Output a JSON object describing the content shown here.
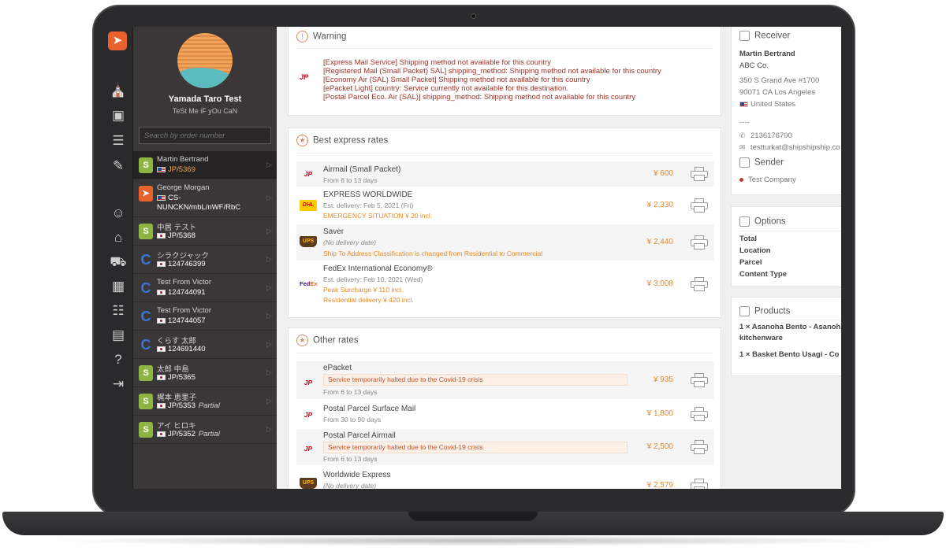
{
  "user": {
    "name": "Yamada Taro Test",
    "tagline": "TeSt Me iF yOu CaN"
  },
  "search": {
    "placeholder": "Search by order number"
  },
  "orders": [
    {
      "name": "Martin Bertrand",
      "ref": "JP/5369",
      "flag": "us",
      "store": "shopify",
      "partial": ""
    },
    {
      "name": "George Morgan",
      "ref": "CS-",
      "ref2": "NUNCKN/mbL/nWF/RbC",
      "flag": "us",
      "store": "rocket",
      "partial": ""
    },
    {
      "name": "中居 テスト",
      "ref": "JP/5368",
      "flag": "jp",
      "store": "shopify",
      "partial": ""
    },
    {
      "name": "シラクジャック",
      "ref": "124746399",
      "flag": "jp",
      "store": "cube",
      "partial": ""
    },
    {
      "name": "Test From Victor",
      "ref": "124744091",
      "flag": "jp",
      "store": "cube",
      "partial": ""
    },
    {
      "name": "Test From Victor",
      "ref": "124744057",
      "flag": "jp",
      "store": "cube",
      "partial": ""
    },
    {
      "name": "くらす 太郎",
      "ref": "124691440",
      "flag": "jp",
      "store": "cube",
      "partial": ""
    },
    {
      "name": "太郎 中島",
      "ref": "JP/5365",
      "flag": "jp",
      "store": "shopify",
      "partial": ""
    },
    {
      "name": "梶本 恵里子",
      "ref": "JP/5353",
      "flag": "jp",
      "store": "shopify",
      "partial": "Partial"
    },
    {
      "name": "アイ ヒロキ",
      "ref": "JP/5352",
      "flag": "jp",
      "store": "shopify",
      "partial": "Partial"
    }
  ],
  "warning": {
    "title": "Warning",
    "lines": [
      "[Express Mail Service] Shipping method not available for this country",
      "[Registered Mail (Small Packet) SAL] shipping_method: Shipping method not available for this country",
      "[Economy Air (SAL) Small Packet] Shipping method not available for this country",
      "[ePacket Light] country: Service currently not available for this destination.",
      "[Postal Parcel Eco. Air (SAL)] shipping_method: Shipping method not available for this country"
    ]
  },
  "best_rates": {
    "title": "Best express rates",
    "rates": [
      {
        "carrier": "JP",
        "name": "Airmail (Small Packet)",
        "sub": "From 6 to 13 days",
        "price": "¥ 600",
        "notes": []
      },
      {
        "carrier": "DHL",
        "name": "EXPRESS WORLDWIDE",
        "sub": "Est. delivery: Feb 5, 2021 (Fri)",
        "price": "¥ 2,330",
        "notes": [
          "EMERGENCY SITUATION ¥ 20 incl."
        ]
      },
      {
        "carrier": "UPS",
        "name": "Saver",
        "sub": "(No delivery date)",
        "price": "¥ 2,440",
        "notes": [
          "Ship To Address Classification is changed from Residential to Commercial"
        ]
      },
      {
        "carrier": "FedEx",
        "name": "FedEx International Economy®",
        "sub": "Est. delivery: Feb 10, 2021 (Wed)",
        "price": "¥ 3,008",
        "notes": [
          "Peak Surcharge ¥ 110 incl.",
          "Residential delivery ¥ 420 incl."
        ]
      }
    ]
  },
  "other_rates": {
    "title": "Other rates",
    "rates": [
      {
        "carrier": "JP",
        "name": "ePacket",
        "halt": "Service temporarily halted due to the Covid-19 crisis",
        "sub": "From 6 to 13 days",
        "price": "¥ 935"
      },
      {
        "carrier": "JP",
        "name": "Postal Parcel Surface Mail",
        "halt": "",
        "sub": "From 30 to 90 days",
        "price": "¥ 1,800"
      },
      {
        "carrier": "JP",
        "name": "Postal Parcel Airmail",
        "halt": "Service temporarily halted due to the Covid-19 crisis",
        "sub": "From 6 to 13 days",
        "price": "¥ 2,500"
      },
      {
        "carrier": "UPS",
        "name": "Worldwide Express",
        "halt": "",
        "sub": "(No delivery date)",
        "price": "¥ 2,579"
      }
    ]
  },
  "receiver": {
    "title": "Receiver",
    "name": "Martin Bertrand",
    "company": "ABC Co.",
    "address1": "350 S Grand Ave #1700",
    "address2": "90071 CA Los Angeles",
    "country": "United States",
    "dashes": "----",
    "phone": "2136176700",
    "email": "testturkat@shipshipship.co"
  },
  "sender": {
    "title": "Sender",
    "name": "Test Company"
  },
  "options": {
    "title": "Options",
    "rows": [
      "Total",
      "Location",
      "Parcel",
      "Content Type"
    ]
  },
  "products": {
    "title": "Products",
    "line1": "1 × Asanoha Bento - Asanoh",
    "line1b": "kitchenware",
    "line2": "1 × Basket Bento Usagi - Co"
  },
  "colors": {
    "accent": "#e68a25",
    "brand": "#e8632b",
    "warning_text": "#a0332a",
    "sidebar": "#3b3738"
  }
}
